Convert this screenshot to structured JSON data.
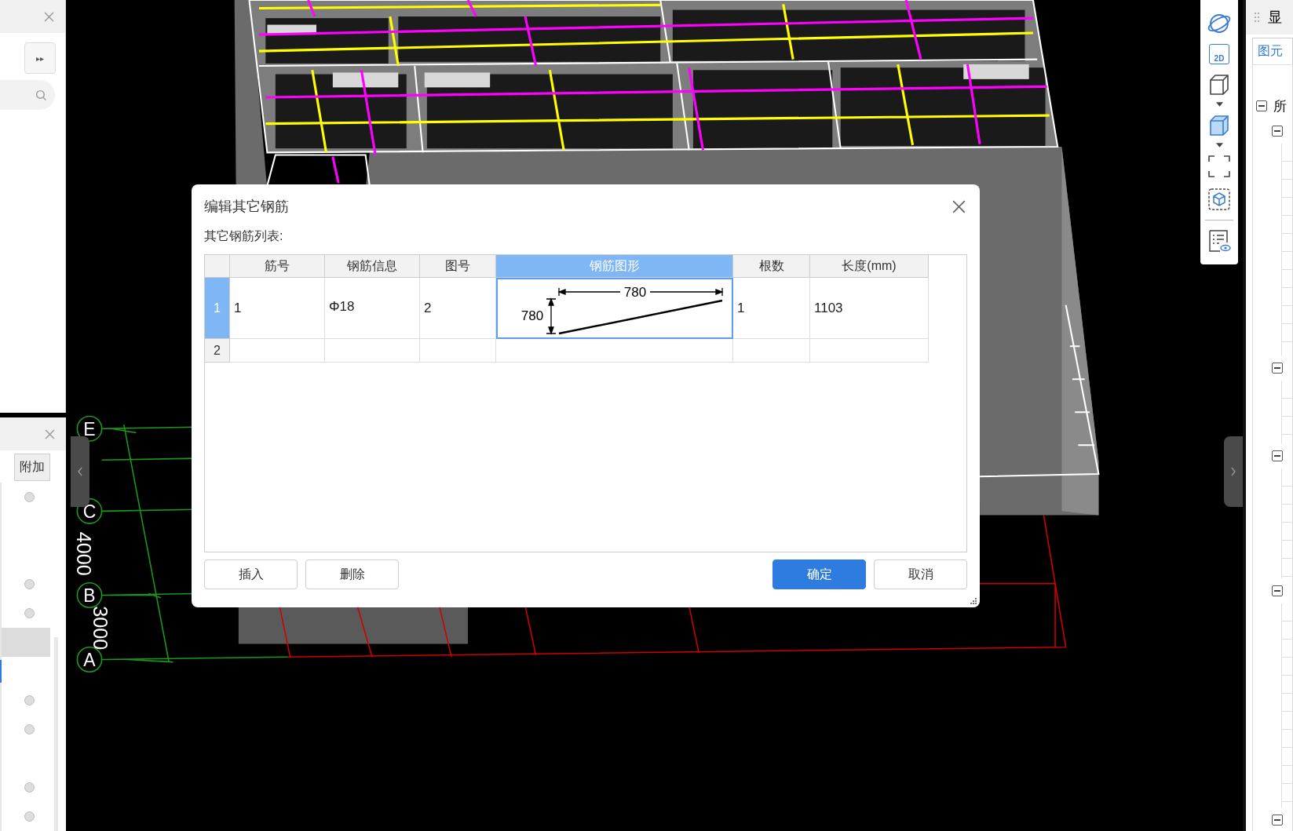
{
  "left_panel": {
    "top_section": {
      "expand_glyph": "▸▸"
    },
    "bottom_section": {
      "column_header": "附加"
    },
    "rows": [
      {
        "kind": "radio",
        "selected": false,
        "focused": false
      },
      {
        "kind": "blank",
        "selected": false,
        "focused": false
      },
      {
        "kind": "blank",
        "selected": false,
        "focused": false
      },
      {
        "kind": "radio",
        "selected": false,
        "focused": false
      },
      {
        "kind": "radio",
        "selected": false,
        "focused": false
      },
      {
        "kind": "blank",
        "selected": true,
        "focused": false
      },
      {
        "kind": "blank",
        "selected": false,
        "focused": true
      },
      {
        "kind": "radio",
        "selected": false,
        "focused": false
      },
      {
        "kind": "radio",
        "selected": false,
        "focused": false
      },
      {
        "kind": "blank",
        "selected": false,
        "focused": false
      },
      {
        "kind": "radio",
        "selected": false,
        "focused": false
      },
      {
        "kind": "radio",
        "selected": false,
        "focused": false
      }
    ]
  },
  "canvas": {
    "axes": [
      {
        "label": "E"
      },
      {
        "label": "C"
      },
      {
        "label": "B"
      },
      {
        "label": "A"
      }
    ],
    "spans": [
      {
        "label": "4000"
      },
      {
        "label": "3000"
      }
    ]
  },
  "dialog": {
    "title": "编辑其它钢筋",
    "list_label": "其它钢筋列表:",
    "columns": [
      {
        "label": "筋号",
        "selected": false
      },
      {
        "label": "钢筋信息",
        "selected": false
      },
      {
        "label": "图号",
        "selected": false
      },
      {
        "label": "钢筋图形",
        "selected": true
      },
      {
        "label": "根数",
        "selected": false
      },
      {
        "label": "长度(mm)",
        "selected": false
      }
    ],
    "rows": [
      {
        "number": "1",
        "selected": true,
        "bar_no": "1",
        "bar_info": "Φ18",
        "shape_no": "2",
        "shape": {
          "top_dim": "780",
          "side_dim": "780"
        },
        "count": "1",
        "length": "1103"
      },
      {
        "number": "2",
        "selected": false
      }
    ],
    "buttons": [
      {
        "label": "插入",
        "kind": "secondary"
      },
      {
        "label": "删除",
        "kind": "secondary"
      },
      {
        "label": "确定",
        "kind": "primary"
      },
      {
        "label": "取消",
        "kind": "secondary"
      }
    ]
  },
  "view_toolbar": {
    "twod_label": "2D"
  },
  "right_panel": {
    "title": "显",
    "tab": "图元",
    "tree": [
      {
        "label": "所",
        "expanded": true,
        "children": [
          {
            "expanded": true
          },
          {
            "expanded": true
          },
          {
            "expanded": true
          },
          {
            "expanded": true
          },
          {
            "expanded": true
          }
        ]
      }
    ]
  }
}
